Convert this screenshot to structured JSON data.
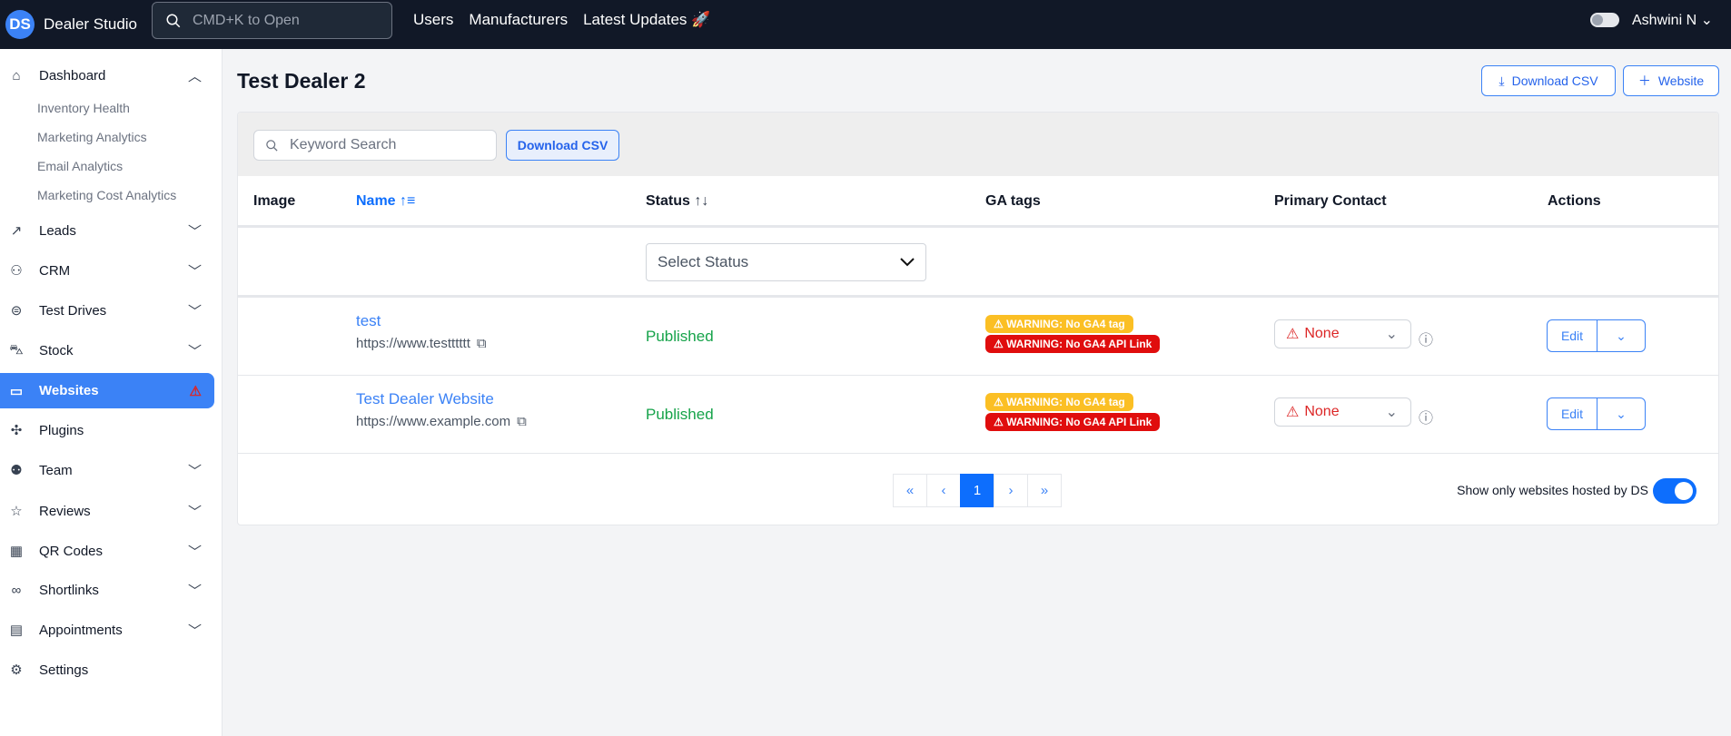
{
  "topbar": {
    "logo": "DS",
    "brand": "Dealer Studio",
    "search_placeholder": "CMD+K to Open",
    "nav": [
      "Users",
      "Manufacturers",
      "Latest Updates"
    ],
    "user": "Ashwini N"
  },
  "sidebar": {
    "dashboard": "Dashboard",
    "sub": [
      "Inventory Health",
      "Marketing Analytics",
      "Email Analytics",
      "Marketing Cost Analytics"
    ],
    "items": [
      "Leads",
      "CRM",
      "Test Drives",
      "Stock",
      "Websites",
      "Plugins",
      "Team",
      "Reviews",
      "QR Codes",
      "Shortlinks",
      "Appointments",
      "Settings"
    ]
  },
  "page": {
    "title": "Test Dealer 2",
    "download_csv": "Download CSV",
    "add_website": "Website"
  },
  "table": {
    "search_placeholder": "Keyword Search",
    "download_csv": "Download CSV",
    "columns": [
      "Image",
      "Name",
      "Status",
      "GA tags",
      "Primary Contact",
      "Actions"
    ],
    "status_filter_placeholder": "Select Status",
    "rows": [
      {
        "name": "test",
        "url": "https://www.testttttt",
        "status": "Published",
        "warnings": [
          "WARNING: No GA4 tag",
          "WARNING: No GA4 API Link"
        ],
        "contact": "None",
        "edit": "Edit"
      },
      {
        "name": "Test Dealer Website",
        "url": "https://www.example.com",
        "status": "Published",
        "warnings": [
          "WARNING: No GA4 tag",
          "WARNING: No GA4 API Link"
        ],
        "contact": "None",
        "edit": "Edit"
      }
    ],
    "pagination": {
      "first": "«",
      "prev": "‹",
      "current": "1",
      "next": "›",
      "last": "»"
    },
    "hosted_toggle_label": "Show only websites hosted by DS",
    "hosted_toggle_on": true
  },
  "colors": {
    "accent": "#3b82f6",
    "topbar": "#111827",
    "published": "#16a34a",
    "warn_yellow": "#fbbf24",
    "warn_red": "#e00d0d"
  }
}
